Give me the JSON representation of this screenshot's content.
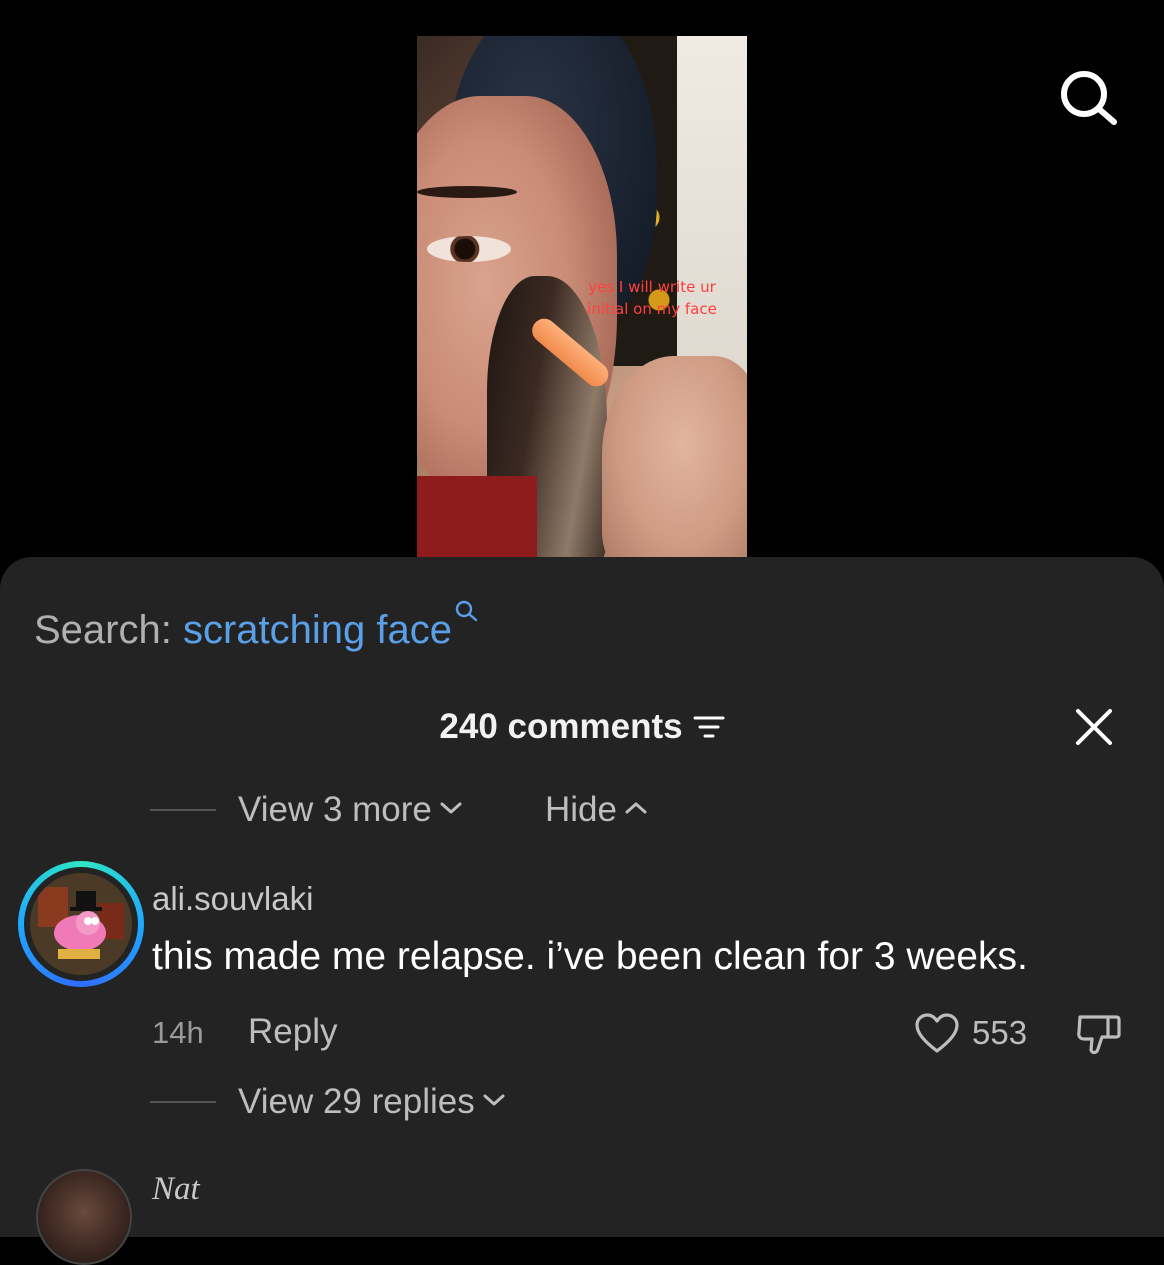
{
  "video": {
    "overlay_caption": "yes I will write ur initial on my face"
  },
  "top_bar": {
    "search_icon": "search-icon"
  },
  "search_suggestion": {
    "prefix": "Search:",
    "term": "scratching face",
    "icon": "search-icon"
  },
  "comments": {
    "count_label": "240 comments",
    "filter_icon": "sort-filter-icon",
    "close_icon": "close-icon",
    "view_more_label": "View 3 more",
    "hide_label": "Hide",
    "items": [
      {
        "username": "ali.souvlaki",
        "text": "this made me relapse. i’ve been clean for 3 weeks.",
        "time": "14h",
        "reply_label": "Reply",
        "likes": "553",
        "view_replies_label": "View 29 replies",
        "avatar_ring_colors": [
          "#2ee6c4",
          "#1fa8ff",
          "#2f6dff"
        ]
      },
      {
        "username": "Nat"
      }
    ]
  },
  "colors": {
    "sheet_background": "#232323",
    "link_blue": "#5aa0e8",
    "page_background": "#000000"
  }
}
